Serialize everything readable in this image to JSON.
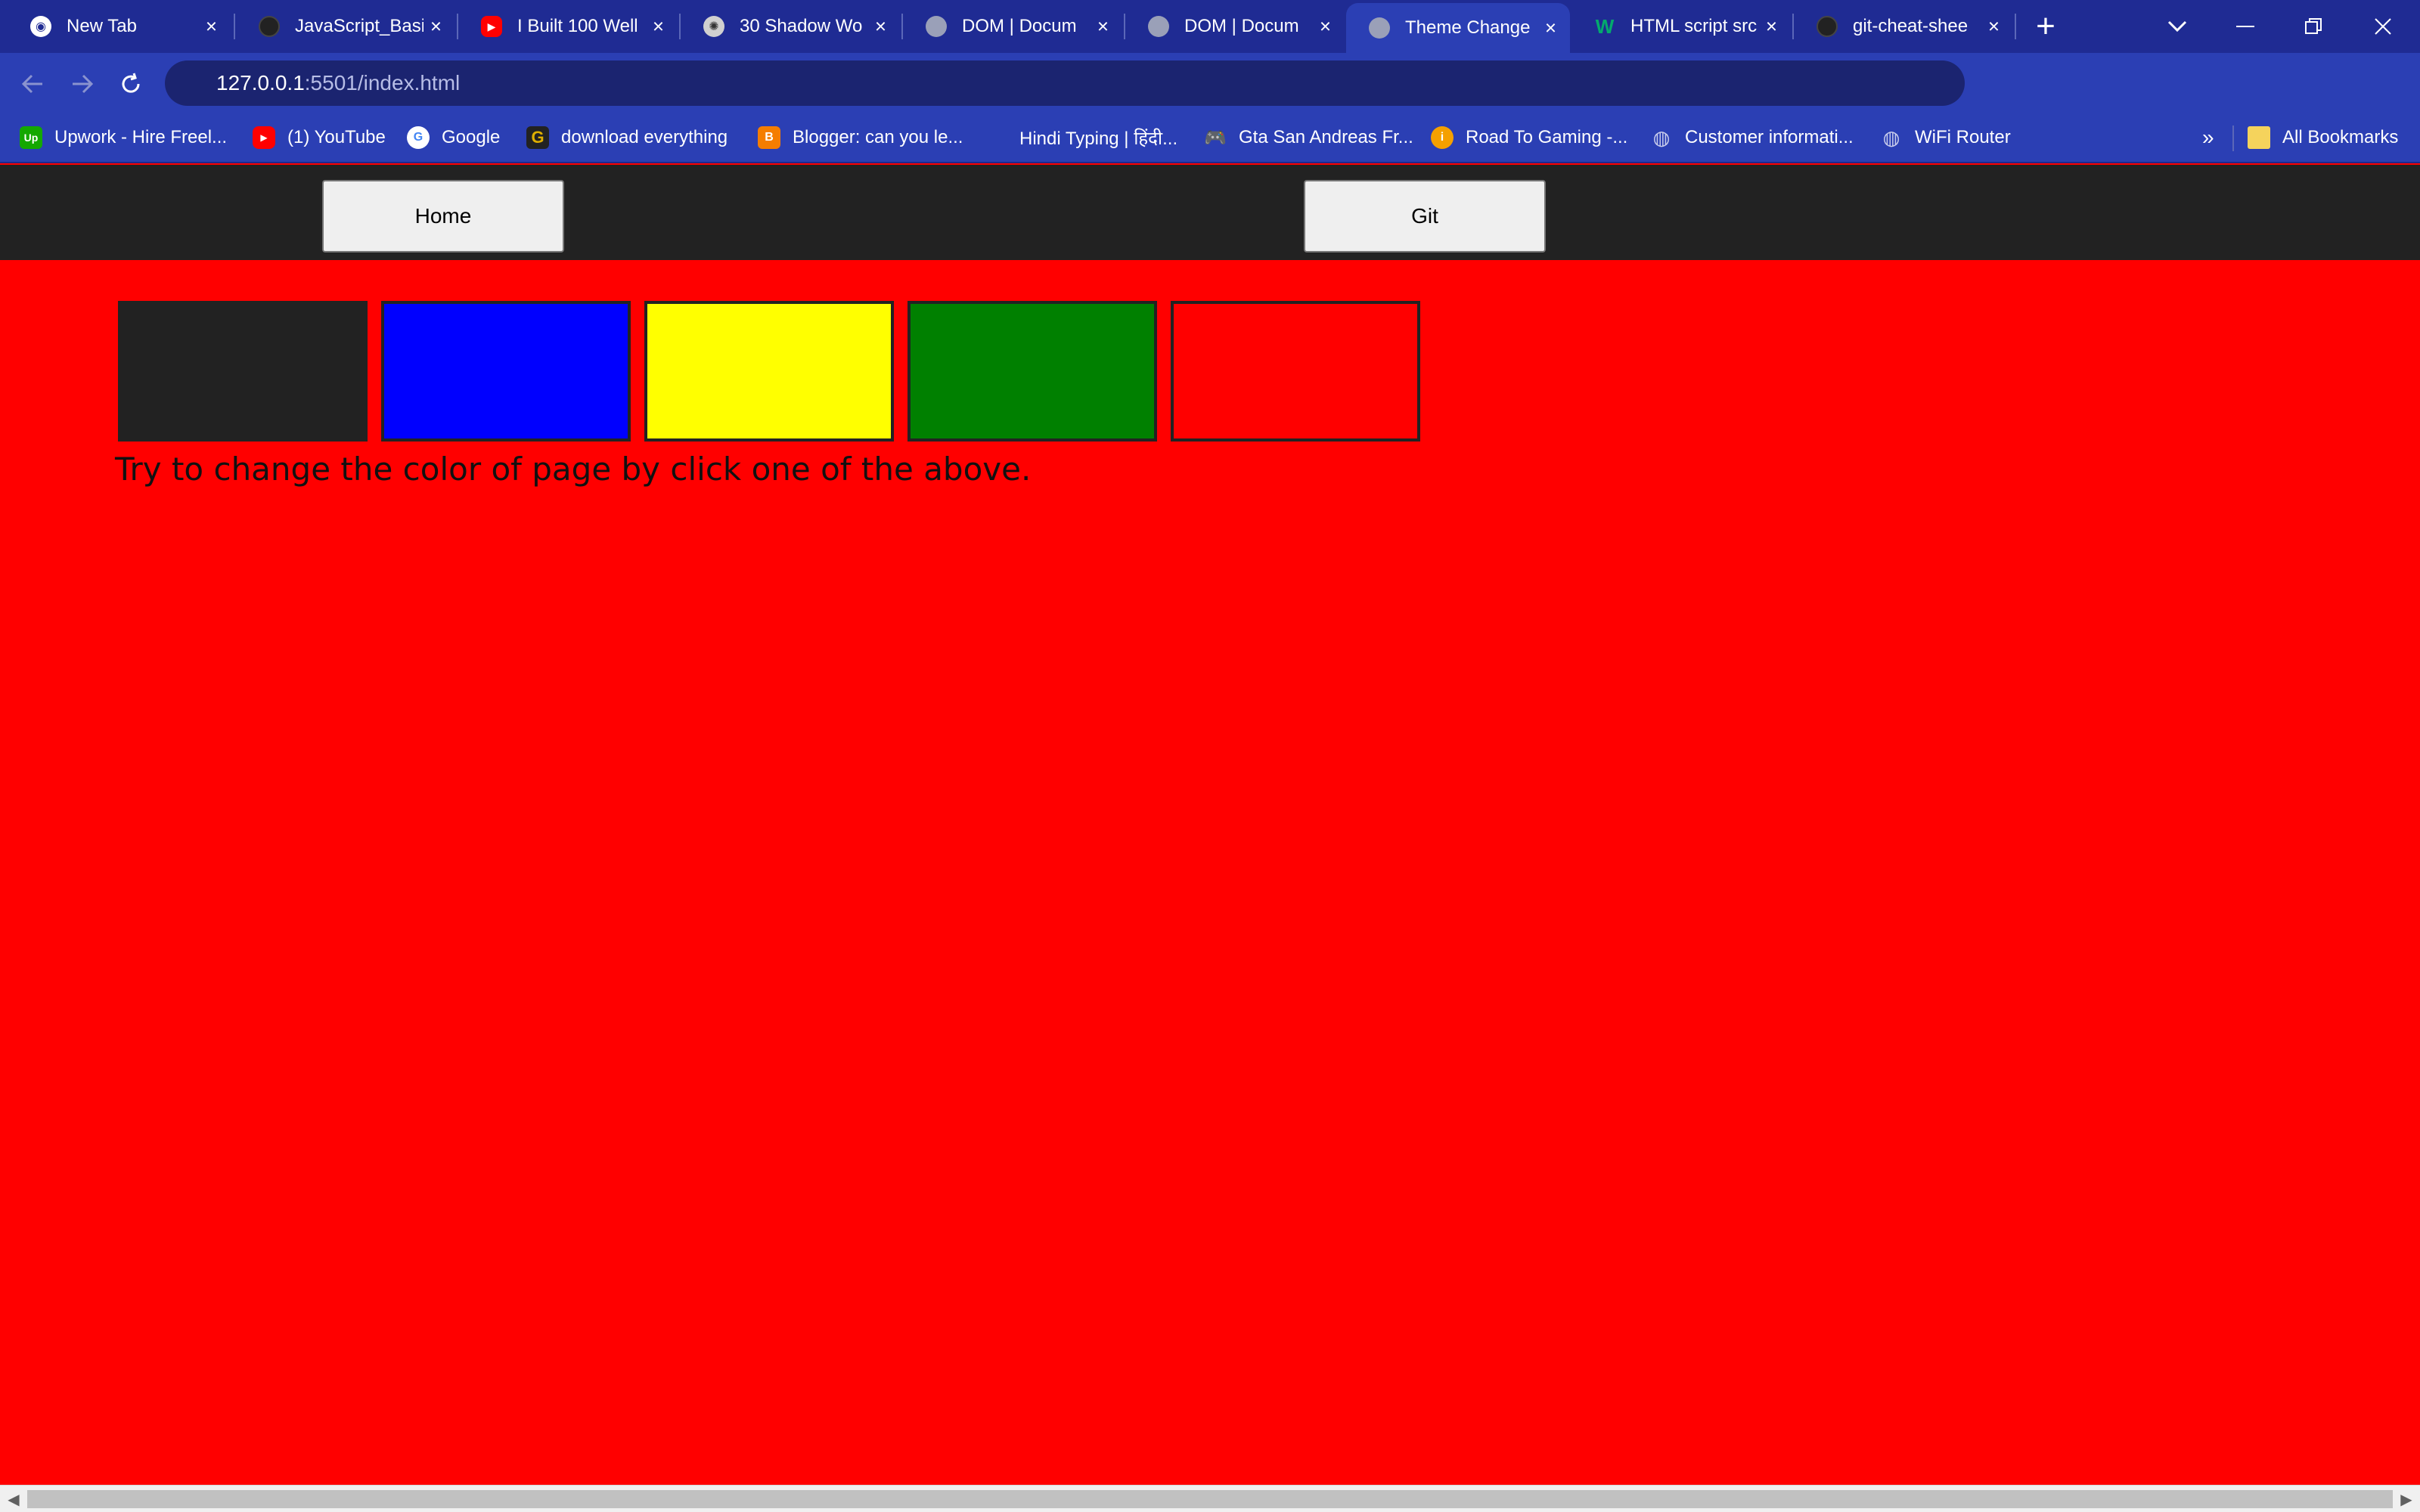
{
  "browser": {
    "tabs": [
      {
        "title": "New Tab",
        "icon": "chrome-icon",
        "icon_color": "#ffffff",
        "active": false
      },
      {
        "title": "JavaScript_Basi",
        "icon": "github-icon",
        "icon_color": "#222222",
        "active": false
      },
      {
        "title": "I Built 100 Well",
        "icon": "youtube-icon",
        "icon_color": "#ff0000",
        "active": false
      },
      {
        "title": "30 Shadow Wo",
        "icon": "web-icon",
        "icon_color": "#d0d0d0",
        "active": false
      },
      {
        "title": "DOM | Docum",
        "icon": "globe-icon",
        "icon_color": "#9aa0b8",
        "active": false
      },
      {
        "title": "DOM | Docum",
        "icon": "globe-icon",
        "icon_color": "#9aa0b8",
        "active": false
      },
      {
        "title": "Theme Change",
        "icon": "globe-icon",
        "icon_color": "#9aa0b8",
        "active": true
      },
      {
        "title": "HTML script src",
        "icon": "w3-icon",
        "icon_color": "#04aa6d",
        "active": false
      },
      {
        "title": "git-cheat-shee",
        "icon": "github-icon",
        "icon_color": "#222222",
        "active": false
      }
    ],
    "tab_close_glyph": "×",
    "new_tab_glyph": "+",
    "url_host": "127.0.0.1",
    "url_rest": ":5501/index.html",
    "bookmarks": [
      {
        "label": "Upwork - Hire Freel...",
        "icon": "upwork-icon",
        "icon_text": "Up",
        "icon_color": "#14a800"
      },
      {
        "label": "(1) YouTube",
        "icon": "youtube-icon",
        "icon_text": "▶",
        "icon_color": "#ff0000"
      },
      {
        "label": "Google",
        "icon": "google-icon",
        "icon_text": "G",
        "icon_color": "#4285f4"
      },
      {
        "label": "download everything",
        "icon": "g-icon",
        "icon_text": "G",
        "icon_color": "#c8a000"
      },
      {
        "label": "Blogger: can you le...",
        "icon": "blogger-icon",
        "icon_text": "B",
        "icon_color": "#f57d00"
      },
      {
        "label": "Hindi Typing | हिंदी...",
        "icon": "",
        "icon_text": "",
        "icon_color": ""
      },
      {
        "label": "Gta San Andreas Fr...",
        "icon": "gamepad-icon",
        "icon_text": "🎮",
        "icon_color": "#c0303a"
      },
      {
        "label": "Road To Gaming -...",
        "icon": "info-icon",
        "icon_text": "i",
        "icon_color": "#f5a000"
      },
      {
        "label": "Customer informati...",
        "icon": "globe-icon",
        "icon_text": "◍",
        "icon_color": "#9aa0b8"
      },
      {
        "label": "WiFi Router",
        "icon": "globe-icon",
        "icon_text": "◍",
        "icon_color": "#9aa0b8"
      }
    ],
    "bookmarks_overflow": "»",
    "all_bookmarks": "All Bookmarks"
  },
  "page": {
    "background_color": "#ff0000",
    "nav": {
      "home_label": "Home",
      "git_label": "Git"
    },
    "swatches": [
      {
        "name": "dark",
        "color": "#222222"
      },
      {
        "name": "blue",
        "color": "#0000ff"
      },
      {
        "name": "yellow",
        "color": "#ffff00"
      },
      {
        "name": "green",
        "color": "#008000"
      },
      {
        "name": "red",
        "color": "#ff0000"
      }
    ],
    "hint": "Try to change the color of page by click one of the above."
  }
}
